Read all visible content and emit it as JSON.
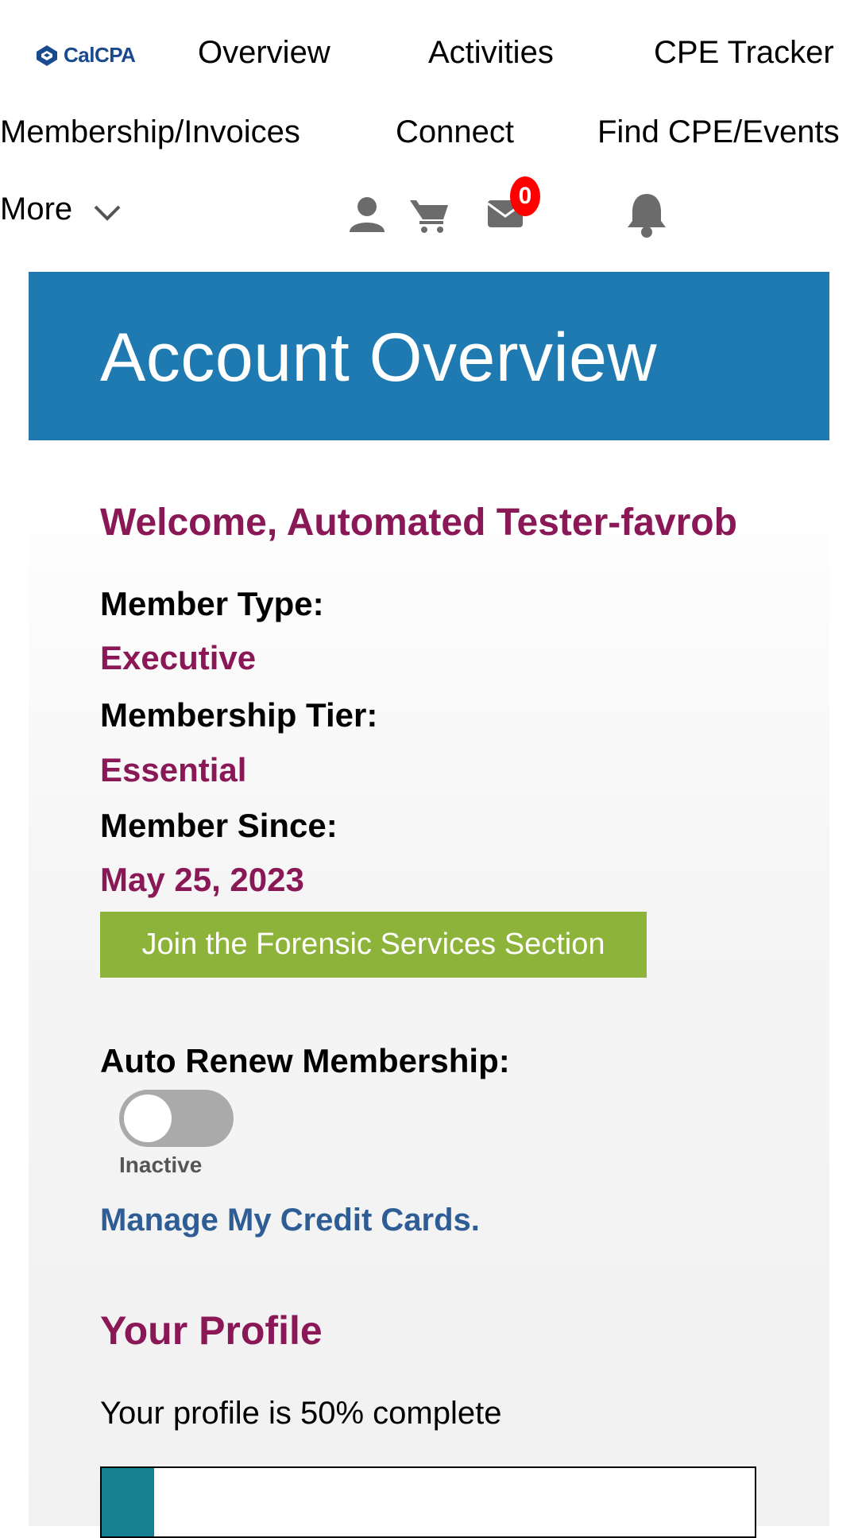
{
  "header": {
    "logo_text": "CalCPA",
    "nav_items": [
      "Overview",
      "Activities",
      "CPE Tracker",
      "Membership/Invoices",
      "Connect",
      "Find CPE/Events"
    ],
    "more_label": "More",
    "icons": [
      "user-icon",
      "cart-icon",
      "mail-icon",
      "bell-icon"
    ],
    "mail_badge_count": "0"
  },
  "banner": {
    "title": "Account Overview"
  },
  "account": {
    "welcome": "Welcome, Automated Tester-favrob",
    "member_type_label": "Member Type:",
    "member_type_value": "Executive",
    "tier_label": "Membership Tier:",
    "tier_value": "Essential",
    "since_label": "Member Since:",
    "since_value": "May 25, 2023",
    "join_button": "Join the Forensic Services Section",
    "auto_renew_label": "Auto Renew Membership:",
    "auto_renew_state": "Inactive",
    "auto_renew_on": false,
    "manage_cards_link": "Manage My Credit Cards."
  },
  "profile": {
    "title": "Your Profile",
    "completion_text": "Your profile is 50% complete",
    "completion_fill_fraction": 0.08
  },
  "colors": {
    "banner_bg": "#1e7ab0",
    "accent_purple": "#8a1756",
    "join_button_bg": "#8db33b",
    "link_blue": "#2e5d96",
    "progress_fill": "#177f92",
    "badge_red": "#ff0000"
  }
}
